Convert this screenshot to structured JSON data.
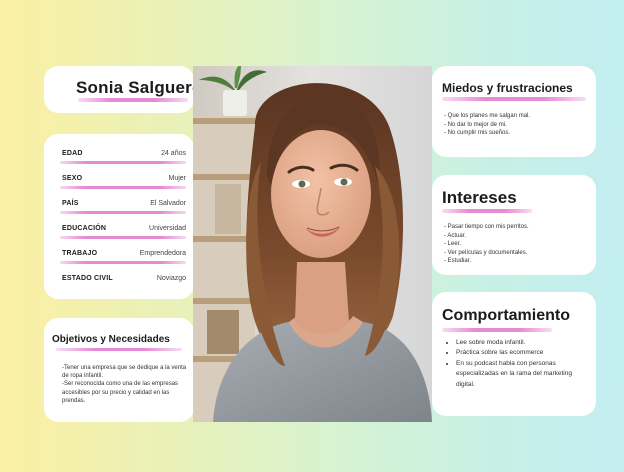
{
  "persona": {
    "name": "Sonia Salguero",
    "info": [
      {
        "label": "EDAD",
        "value": "24 años"
      },
      {
        "label": "SEXO",
        "value": "Mujer"
      },
      {
        "label": "PAÍS",
        "value": "El Salvador"
      },
      {
        "label": "EDUCACIÓN",
        "value": "Universidad"
      },
      {
        "label": "TRABAJO",
        "value": "Emprendedora"
      },
      {
        "label": "ESTADO CIVIL",
        "value": "Noviazgo"
      }
    ]
  },
  "objectives": {
    "title": "Objetivos y Necesidades",
    "lines": [
      "-Tener una empresa que se dedique a la venta de ropa infantil.",
      "-Ser reconocida como una de las empresas accesibles por su precio y calidad en las prendas."
    ]
  },
  "fears": {
    "title": "Miedos y frustraciones",
    "items": [
      "- Que los planes me salgan mal.",
      "- No dar lo mejor de mi.",
      "- No cumplir mis sueños."
    ]
  },
  "interests": {
    "title": "Intereses",
    "items": [
      "- Pasar tiempo con mis perritos.",
      "- Actuar.",
      "- Leer.",
      "- Ver películas y documentales.",
      "- Estudiar."
    ]
  },
  "behavior": {
    "title": "Comportamiento",
    "items": [
      "Lee sobre moda infantil.",
      "Práctica sobre las ecommerce",
      "En su podcast habla con personas especializadas en la rama del marketing digital."
    ]
  },
  "colors": {
    "accent": "#e58ad6",
    "bg_left": "#fbefa3",
    "bg_right": "#c3eef1"
  }
}
